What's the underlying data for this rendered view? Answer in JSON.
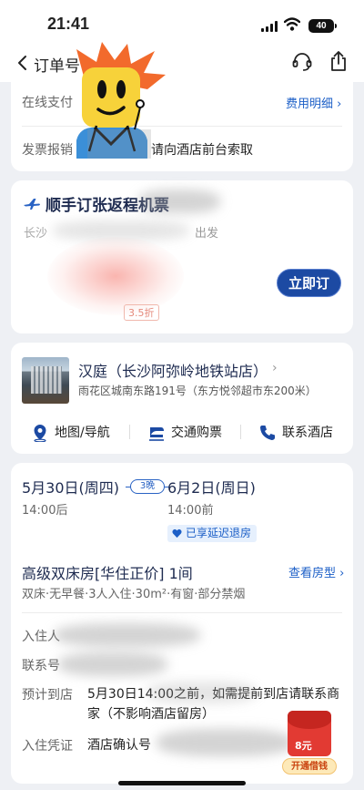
{
  "status_bar": {
    "time": "21:41",
    "battery": "40"
  },
  "nav": {
    "title": "订单号"
  },
  "payment": {
    "online_label": "在线支付",
    "fee_link": "费用明细",
    "invoice_label": "发票报销",
    "invoice_text": "，请向酒店前台索取"
  },
  "flight": {
    "title": "顺手订张返程机票",
    "route": "长沙",
    "depart": "出发",
    "discount": "3.5折",
    "book_button": "立即订"
  },
  "hotel": {
    "name": "汉庭（长沙阿弥岭地铁站店）",
    "address": "雨花区城南东路191号（东方悦邻超市东200米）",
    "actions": [
      {
        "label": "地图/导航",
        "icon": "map-pin-icon"
      },
      {
        "label": "交通购票",
        "icon": "ticket-icon"
      },
      {
        "label": "联系酒店",
        "icon": "phone-icon"
      }
    ]
  },
  "order": {
    "checkin_date": "5月30日(周四)",
    "checkin_time": "14:00后",
    "nights": "3晚",
    "checkout_date": "6月2日(周日)",
    "checkout_time": "14:00前",
    "late_checkout": "已享延迟退房",
    "room_title": "高级双床房[华住正价] 1间",
    "room_link": "查看房型",
    "room_desc": "双床·无早餐·3人入住·30m²·有窗·部分禁烟",
    "fields": [
      {
        "label": "入住人",
        "value": ""
      },
      {
        "label": "联系号",
        "value": ""
      },
      {
        "label": "预计到店",
        "value": "5月30日14:00之前，如需提前到店请联系商家（不影响酒店留房）"
      },
      {
        "label": "入住凭证",
        "value": "酒店确认号"
      }
    ]
  },
  "promo": {
    "amount": "8元",
    "label": "开通借钱"
  },
  "colors": {
    "accent": "#1c5fc7",
    "button": "#1c4aa3",
    "title": "#1e2b50",
    "background": "#eef0f4"
  }
}
